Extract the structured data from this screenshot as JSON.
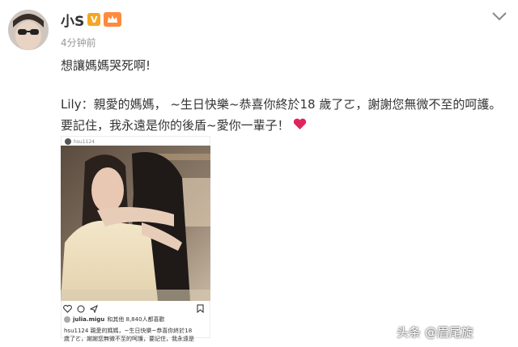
{
  "post": {
    "username": "小S",
    "verified_mark": "V",
    "timestamp": "4分钟前",
    "title": "想讓媽媽哭死啊!",
    "body": "Lily：親愛的媽媽，  ~生日快樂~恭喜你終於18 歲了ㄛ，謝謝您無微不至的呵護。要記住，我永遠是你的後盾~愛你一輩子！"
  },
  "embed": {
    "header_user": "hsu1124",
    "likes_user": "julia.migu",
    "likes_text": "和其他 8,840人都喜歡",
    "caption_line1": "hsu1124 親愛的媽媽，~生日快樂~恭喜你終於18",
    "caption_line2": "歲了ㄛ，謝謝您無微不至的呵護，要記住，我永遠是"
  },
  "watermark": "头条 @眉尾旋",
  "colors": {
    "heart": "#e0245e",
    "verified": "#f5a623",
    "badge": "#ff8a3d",
    "timestamp": "#999999"
  },
  "icons": [
    "chevron-down-icon",
    "heart-emoji-icon",
    "ig-like-icon",
    "ig-comment-icon",
    "ig-share-icon",
    "ig-bookmark-icon"
  ]
}
